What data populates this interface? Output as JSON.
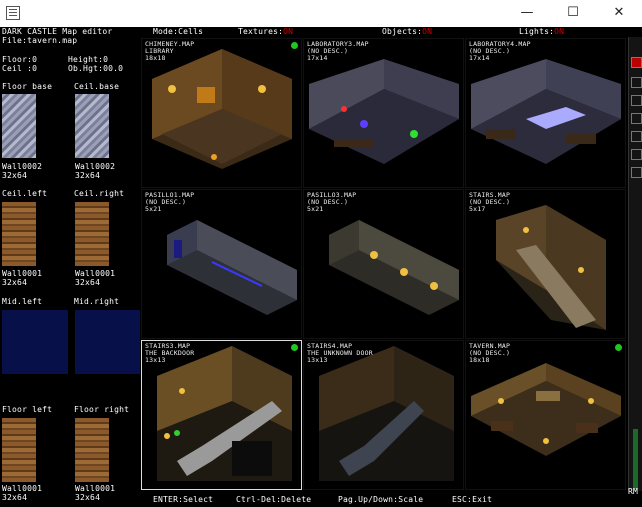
{
  "window": {
    "minimize": "—",
    "maximize": "☐",
    "close": "✕"
  },
  "header": {
    "app_title": "DARK CASTLE Map editor",
    "mode": "Mode:Cells",
    "textures_label": "Textures:",
    "textures_value": "ON",
    "objects_label": "Objects:",
    "objects_value": "ON",
    "lights_label": "Lights:",
    "lights_value": "ON"
  },
  "file": "File:tavern.map",
  "stats": {
    "floor": "Floor:0",
    "height": "Height:0",
    "ceil": "Ceil :0",
    "obj_hgt": "Ob.Hgt:00.0"
  },
  "textures": [
    {
      "label": "Floor base",
      "name": "",
      "size": ""
    },
    {
      "label": "Ceil.base",
      "name": "",
      "size": ""
    },
    {
      "label": "",
      "name": "Wall0002",
      "size": "32x64"
    },
    {
      "label": "",
      "name": "Wall0002",
      "size": "32x64"
    },
    {
      "label": "Ceil.left",
      "name": "Wall0001",
      "size": "32x64"
    },
    {
      "label": "Ceil.right",
      "name": "Wall0001",
      "size": "32x64"
    },
    {
      "label": "Mid.left",
      "name": "",
      "size": ""
    },
    {
      "label": "Mid.right",
      "name": "",
      "size": ""
    },
    {
      "label": "Floor left",
      "name": "Wall0001",
      "size": "32x64"
    },
    {
      "label": "Floor right",
      "name": "Wall0001",
      "size": "32x64"
    }
  ],
  "maps": [
    {
      "file": "CHIMENEY.MAP",
      "desc": "LIBRARY",
      "size": "18x18",
      "active": true
    },
    {
      "file": "LABORATORY3.MAP",
      "desc": "(NO DESC.)",
      "size": "17x14",
      "active": false
    },
    {
      "file": "LABORATORY4.MAP",
      "desc": "(NO DESC.)",
      "size": "17x14",
      "active": false
    },
    {
      "file": "PASILLO1.MAP",
      "desc": "(NO DESC.)",
      "size": "5x21",
      "active": false
    },
    {
      "file": "PASILLO3.MAP",
      "desc": "(NO DESC.)",
      "size": "5x21",
      "active": false
    },
    {
      "file": "STAIRS.MAP",
      "desc": "(NO DESC.)",
      "size": "5x17",
      "active": false
    },
    {
      "file": "STAIRS3.MAP",
      "desc": "THE BACKDOOR",
      "size": "13x13",
      "active": true
    },
    {
      "file": "STAIRS4.MAP",
      "desc": "THE UNKNOWN DOOR",
      "size": "13x13",
      "active": false
    },
    {
      "file": "TAVERN.MAP",
      "desc": "(NO DESC.)",
      "size": "18x18",
      "active": true
    }
  ],
  "footer": {
    "enter": "ENTER:Select",
    "delete": "Ctrl-Del:Delete",
    "scale": "Pag.Up/Down:Scale",
    "exit": "ESC:Exit",
    "rm": "RM"
  },
  "colors": {
    "accent_red": "#cc0000",
    "green_dot": "#1ec81e",
    "navy_texture": "#08104a"
  }
}
